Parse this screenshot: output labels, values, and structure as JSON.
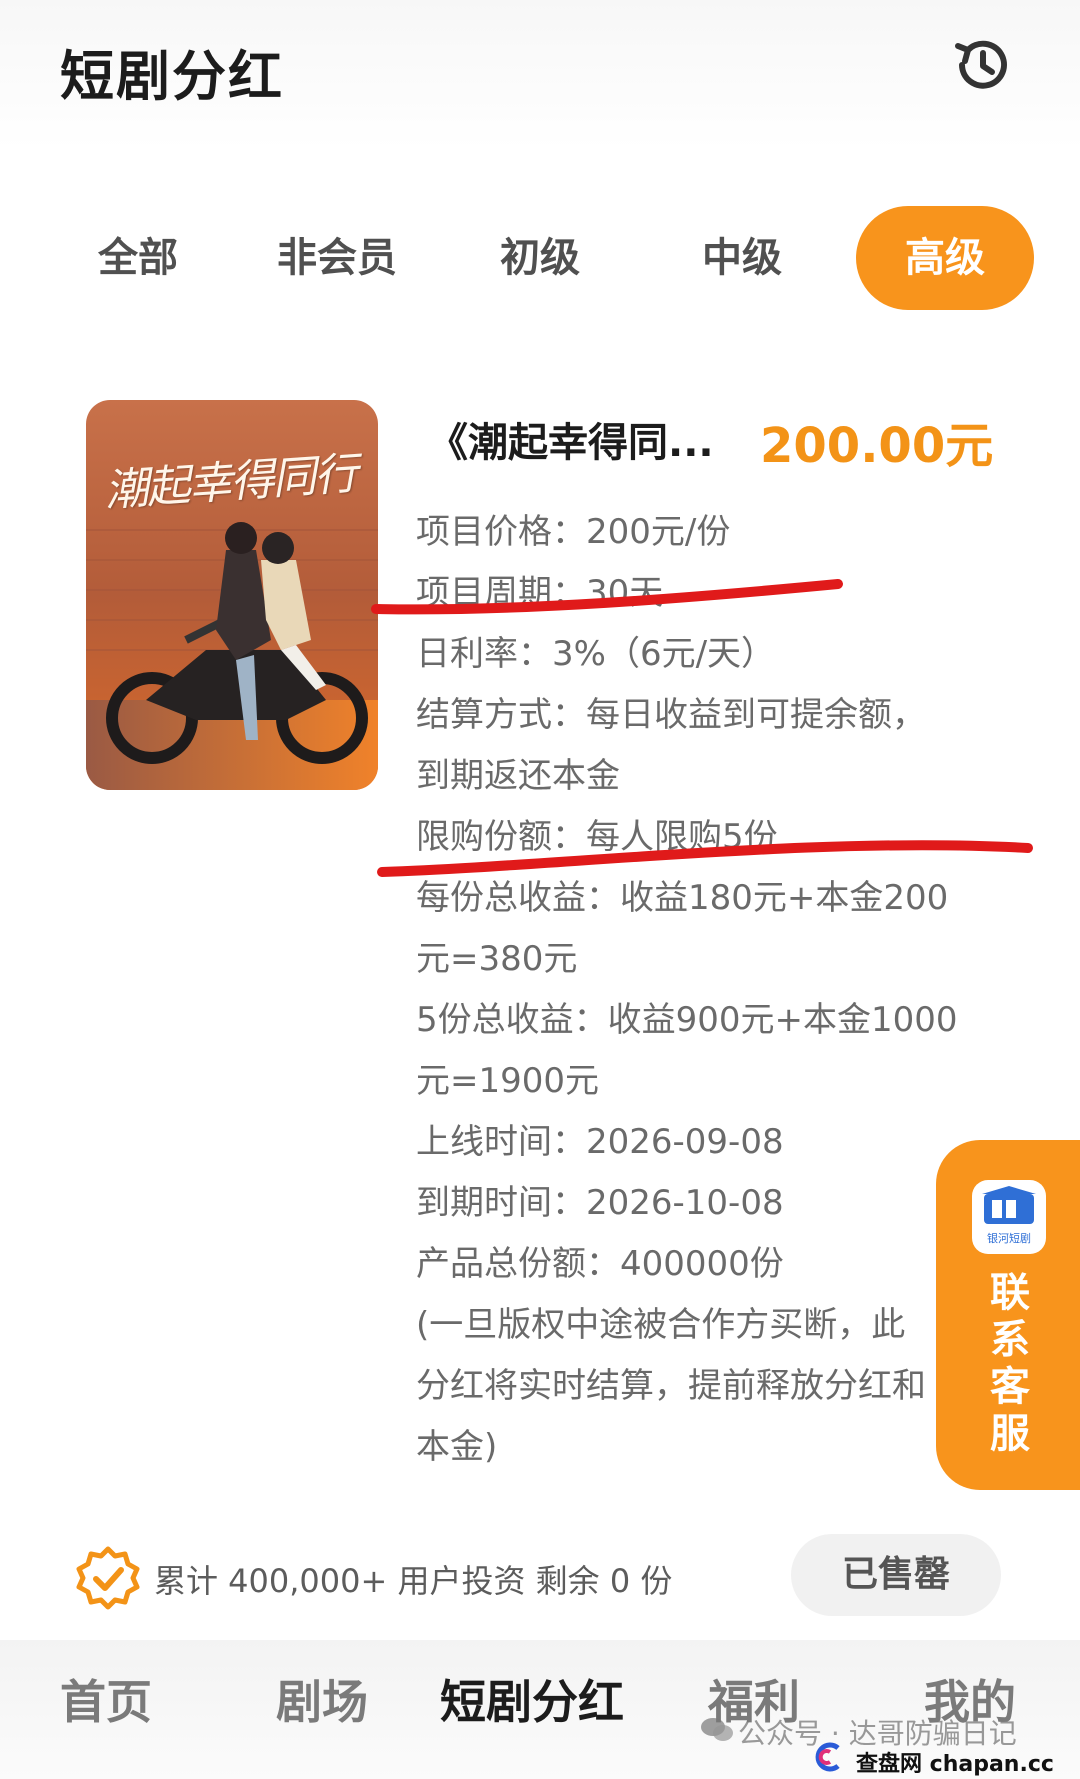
{
  "header": {
    "title": "短剧分红",
    "history_icon": "history-clock-icon"
  },
  "tabs": [
    {
      "label": "全部",
      "active": false
    },
    {
      "label": "非会员",
      "active": false
    },
    {
      "label": "初级",
      "active": false
    },
    {
      "label": "中级",
      "active": false
    },
    {
      "label": "高级",
      "active": true
    }
  ],
  "colors": {
    "accent": "#f8941c",
    "price": "#f39317",
    "annotation_red": "#e01a1a"
  },
  "product": {
    "poster_title": "潮起幸得同行",
    "title": "《潮起幸得同...",
    "price": "200.00元",
    "details": [
      "项目价格：200元/份",
      "项目周期：30天",
      "日利率：3%（6元/天）",
      "结算方式：每日收益到可提余额，",
      "到期返还本金",
      "限购份额：每人限购5份",
      "每份总收益：收益180元+本金200",
      "元=380元",
      "5份总收益：收益900元+本金1000",
      "元=1900元",
      "上线时间：2026-09-08",
      "到期时间：2026-10-08",
      "产品总份额：400000份",
      "(一旦版权中途被合作方买断，此",
      "分红将实时结算，提前释放分红和",
      "本金)"
    ]
  },
  "contact": {
    "label": "联系客服",
    "logo_text": "银河短剧"
  },
  "footer": {
    "investors": "累计 400,000+ 用户投资  剩余 0 份",
    "soldout": "已售罄"
  },
  "nav": [
    {
      "label": "首页",
      "active": false
    },
    {
      "label": "剧场",
      "active": false
    },
    {
      "label": "短剧分红",
      "active": true
    },
    {
      "label": "福利",
      "active": false
    },
    {
      "label": "我的",
      "active": false
    }
  ],
  "watermark": {
    "text": "公众号 · 达哥防骗日记",
    "site": "查盘网  chapan.cc"
  }
}
